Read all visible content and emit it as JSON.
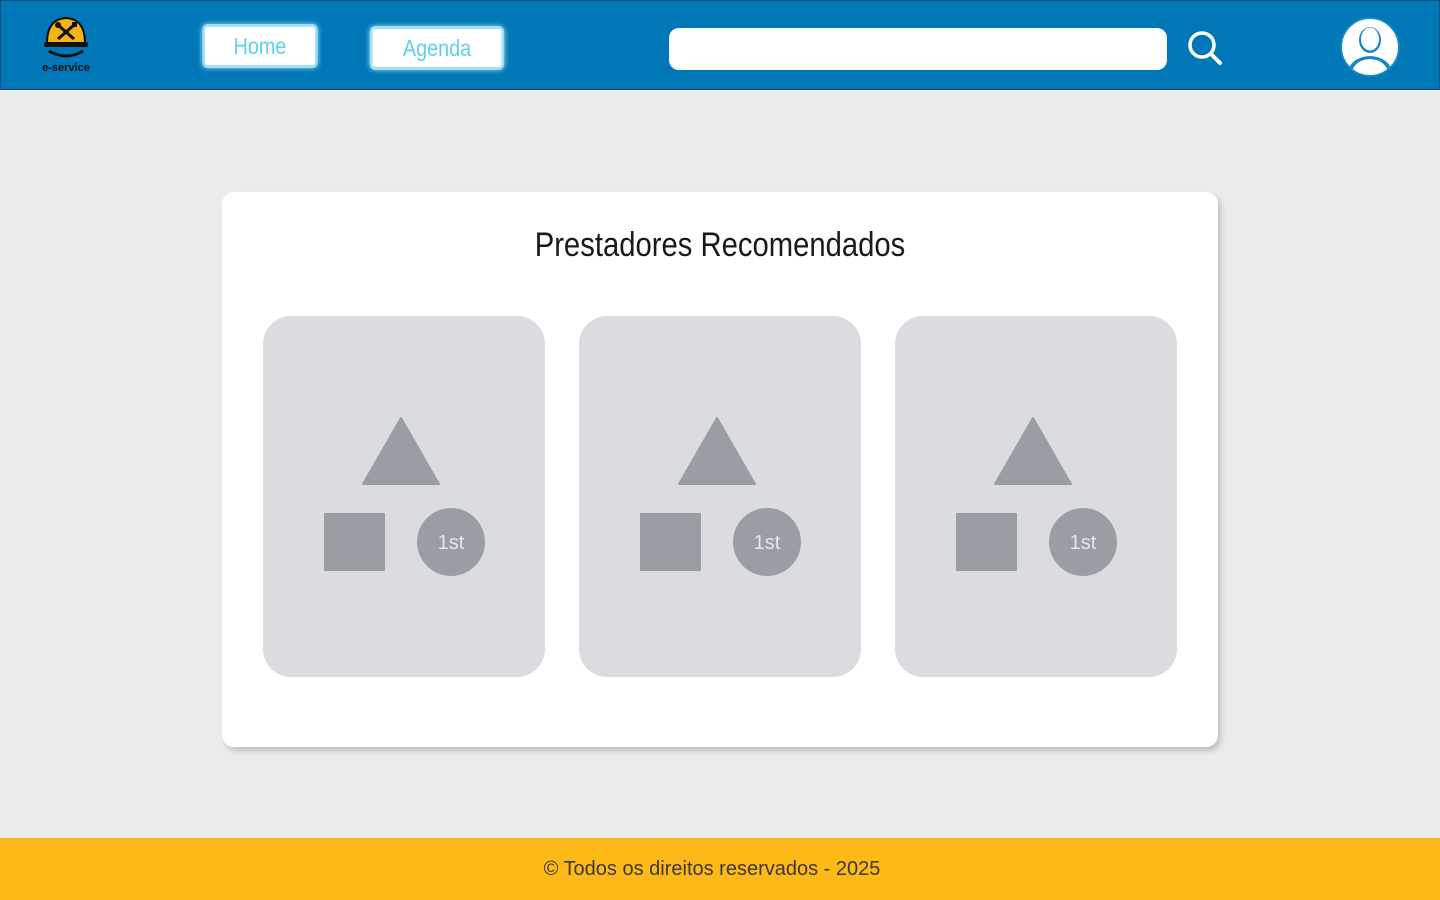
{
  "header": {
    "logo_text": "e-service",
    "nav": {
      "home_label": "Home",
      "agenda_label": "Agenda"
    },
    "search": {
      "value": "",
      "placeholder": ""
    },
    "colors": {
      "header_bg": "#0077b6",
      "nav_text": "#5fd0ec"
    }
  },
  "main": {
    "title": "Prestadores Recomendados",
    "providers": [
      {
        "rank_label": "1st",
        "icon": "image-placeholder-icon"
      },
      {
        "rank_label": "1st",
        "icon": "image-placeholder-icon"
      },
      {
        "rank_label": "1st",
        "icon": "image-placeholder-icon"
      }
    ]
  },
  "footer": {
    "text": "© Todos os direitos reservados - 2025",
    "bg_color": "#fdb917"
  }
}
